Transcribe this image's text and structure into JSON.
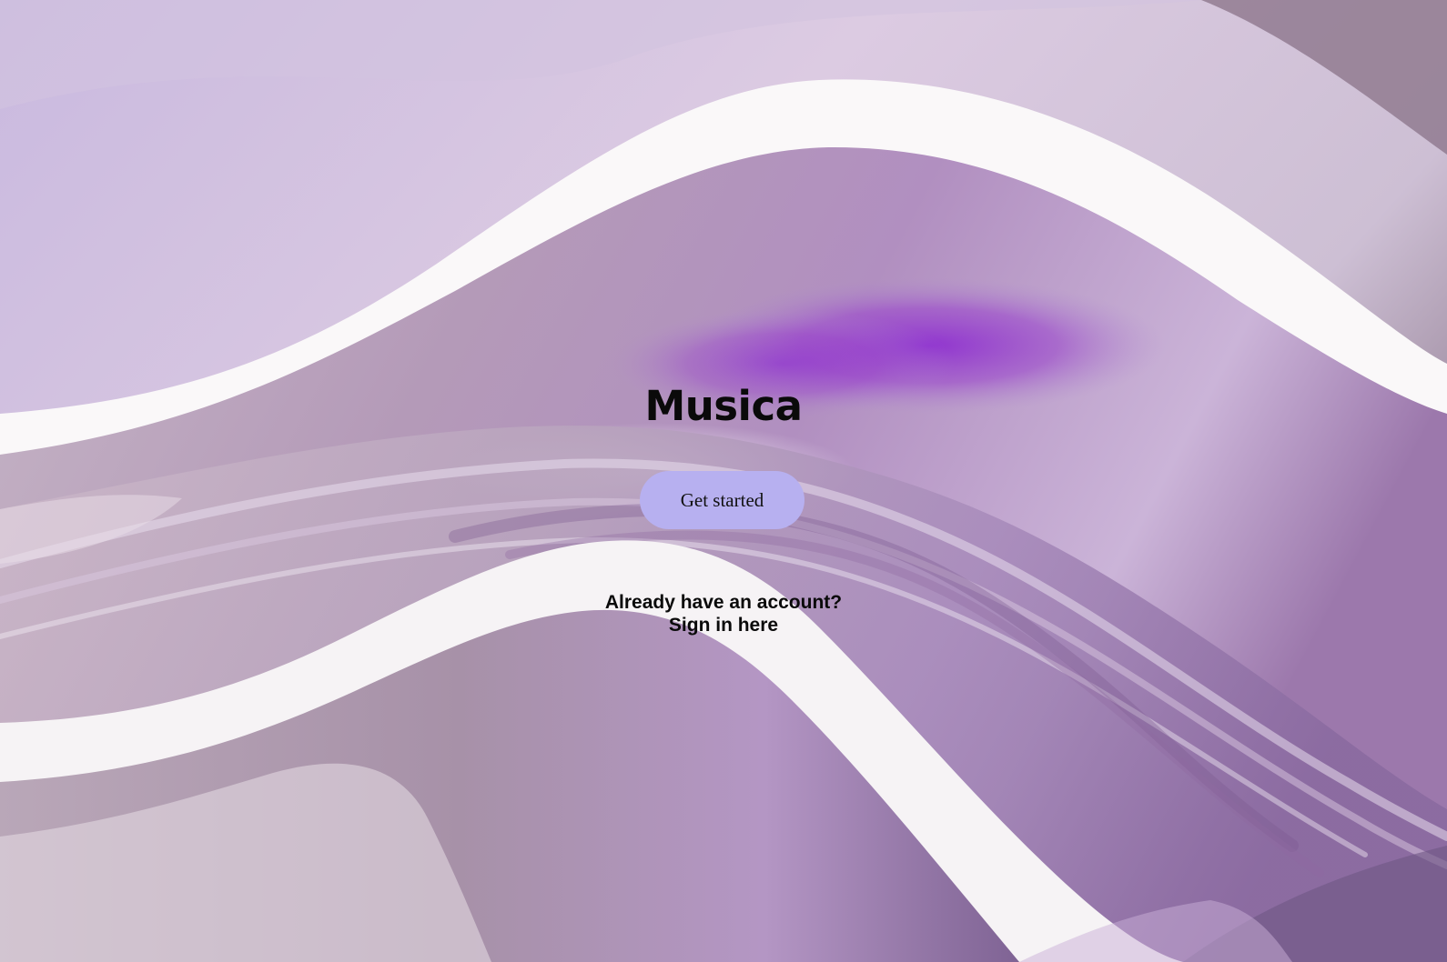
{
  "app": {
    "title": "Musica"
  },
  "hero": {
    "cta_label": "Get started"
  },
  "signin": {
    "prompt": "Already have an account?",
    "link_label": "Sign in here"
  },
  "colors": {
    "cta_background": "#b7b0f0",
    "text": "#0a0a0a",
    "accent_purple": "#8e35c8"
  }
}
